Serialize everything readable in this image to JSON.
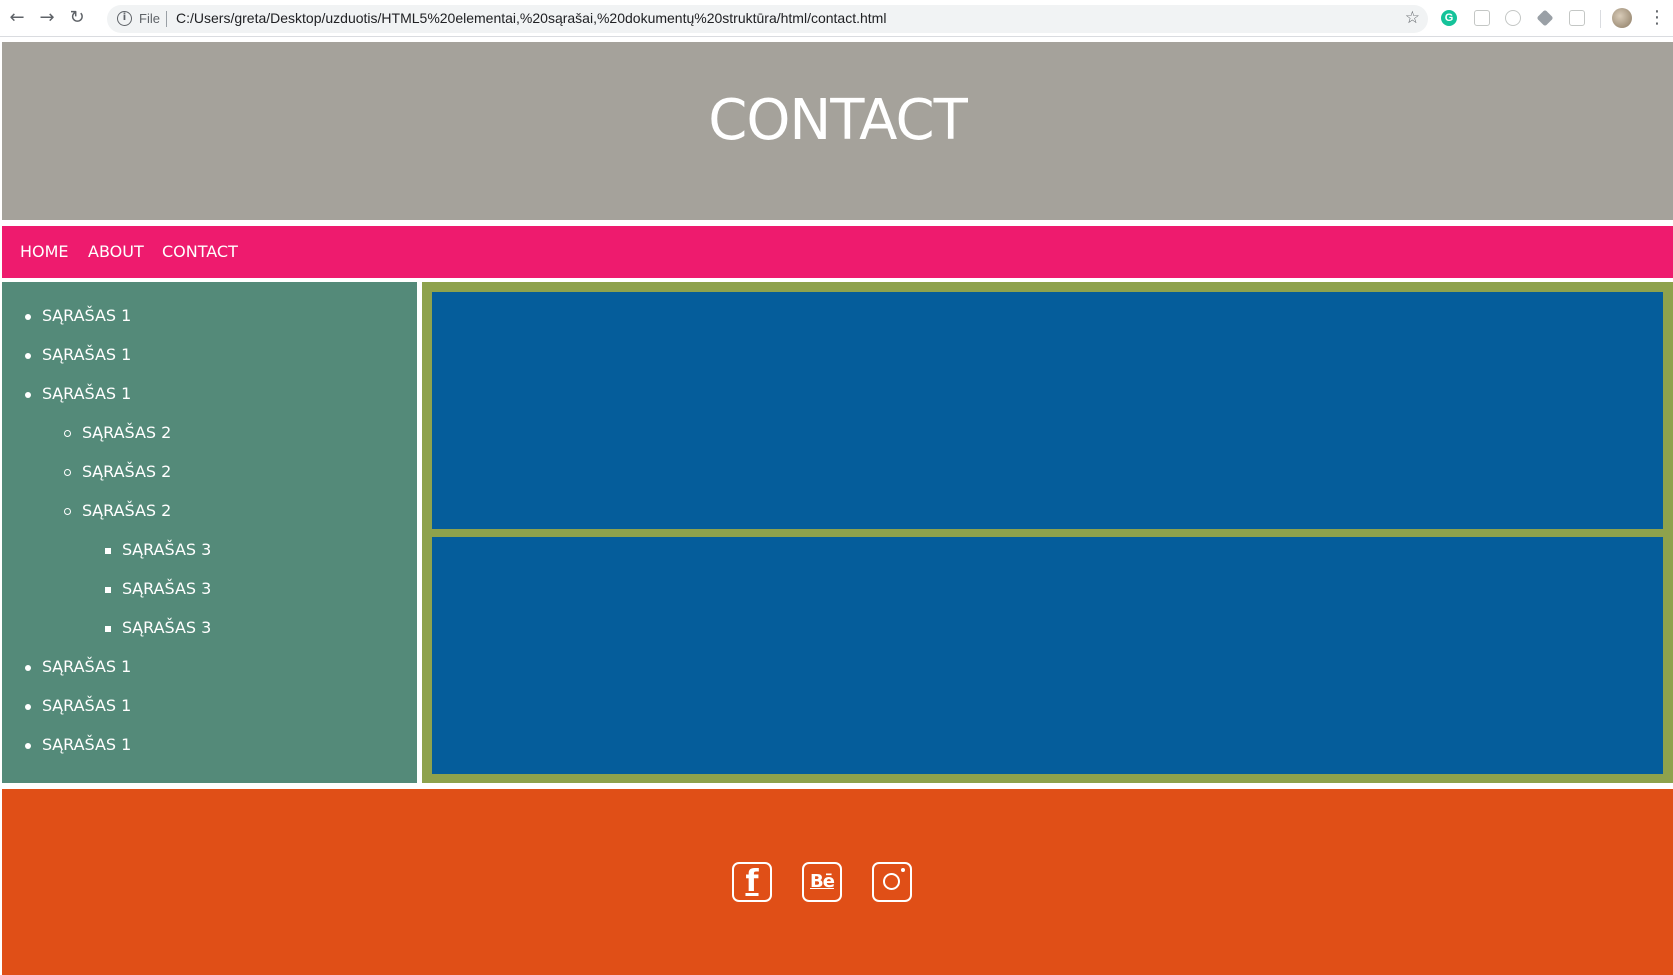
{
  "browser": {
    "back_icon": "←",
    "forward_icon": "→",
    "reload_icon": "↻",
    "scheme_label": "File",
    "url": "C:/Users/greta/Desktop/uzduotis/HTML5%20elementai,%20sąrašai,%20dokumentų%20struktūra/html/contact.html",
    "star_icon": "☆",
    "grammarly_label": "G",
    "menu_icon": "⋮"
  },
  "header": {
    "title": "CONTACT"
  },
  "nav": {
    "items": [
      {
        "label": "HOME"
      },
      {
        "label": "ABOUT"
      },
      {
        "label": "CONTACT"
      }
    ]
  },
  "sidebar": {
    "items": [
      {
        "label": "SĄRAŠAS 1",
        "level": 1
      },
      {
        "label": "SĄRAŠAS 1",
        "level": 1
      },
      {
        "label": "SĄRAŠAS 1",
        "level": 1
      },
      {
        "label": "SĄRAŠAS 2",
        "level": 2
      },
      {
        "label": "SĄRAŠAS 2",
        "level": 2
      },
      {
        "label": "SĄRAŠAS 2",
        "level": 2
      },
      {
        "label": "SĄRAŠAS 3",
        "level": 3
      },
      {
        "label": "SĄRAŠAS 3",
        "level": 3
      },
      {
        "label": "SĄRAŠAS 3",
        "level": 3
      },
      {
        "label": "SĄRAŠAS 1",
        "level": 1
      },
      {
        "label": "SĄRAŠAS 1",
        "level": 1
      },
      {
        "label": "SĄRAŠAS 1",
        "level": 1
      }
    ]
  },
  "footer": {
    "social": [
      {
        "icon": "facebook-icon",
        "glyph": "f"
      },
      {
        "icon": "behance-icon",
        "glyph": "Bē"
      },
      {
        "icon": "instagram-icon"
      }
    ]
  },
  "colors": {
    "header_bg": "#a5a29b",
    "nav_bg": "#ee1b6e",
    "sidebar_bg": "#548a79",
    "main_border": "#8ea24c",
    "main_box": "#055d9b",
    "footer_bg": "#e04f17"
  }
}
